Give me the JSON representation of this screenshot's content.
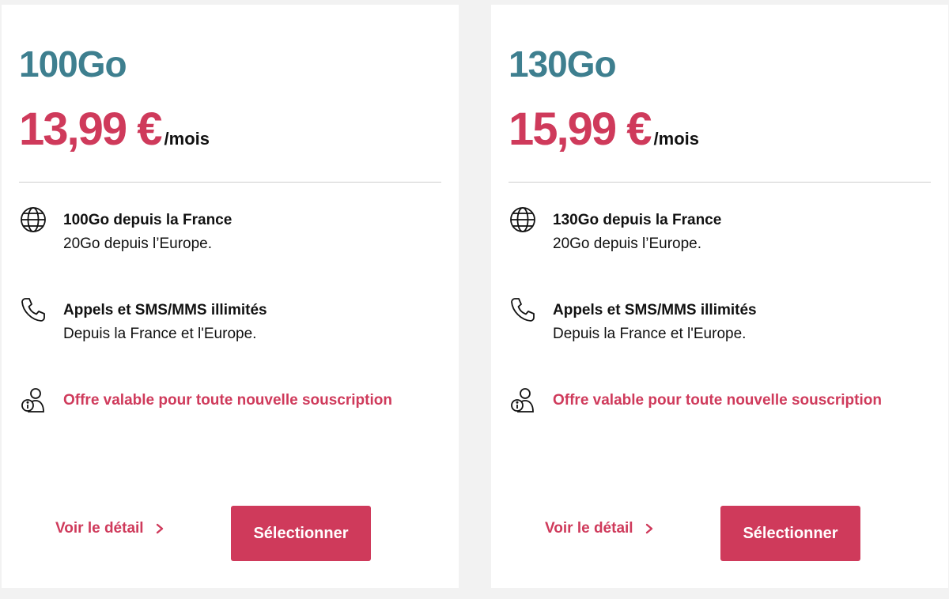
{
  "colors": {
    "accent": "#cf3a5b",
    "title": "#3e7f8f",
    "text": "#111111"
  },
  "offers": [
    {
      "data_title": "100Go",
      "price": "13,99 €",
      "price_unit": "/mois",
      "features": [
        {
          "icon": "globe-icon",
          "title": "100Go depuis la France",
          "subtitle": "20Go depuis l’Europe."
        },
        {
          "icon": "phone-icon",
          "title": "Appels et SMS/MMS illimités",
          "subtitle": "Depuis la France et l'Europe."
        }
      ],
      "notice": {
        "icon": "user-info-icon",
        "text": "Offre valable pour toute nouvelle souscription"
      },
      "detail_label": "Voir le détail",
      "select_label": "Sélectionner"
    },
    {
      "data_title": "130Go",
      "price": "15,99 €",
      "price_unit": "/mois",
      "features": [
        {
          "icon": "globe-icon",
          "title": "130Go depuis la France",
          "subtitle": "20Go depuis l’Europe."
        },
        {
          "icon": "phone-icon",
          "title": "Appels et SMS/MMS illimités",
          "subtitle": "Depuis la France et l'Europe."
        }
      ],
      "notice": {
        "icon": "user-info-icon",
        "text": "Offre valable pour toute nouvelle souscription"
      },
      "detail_label": "Voir le détail",
      "select_label": "Sélectionner"
    }
  ]
}
